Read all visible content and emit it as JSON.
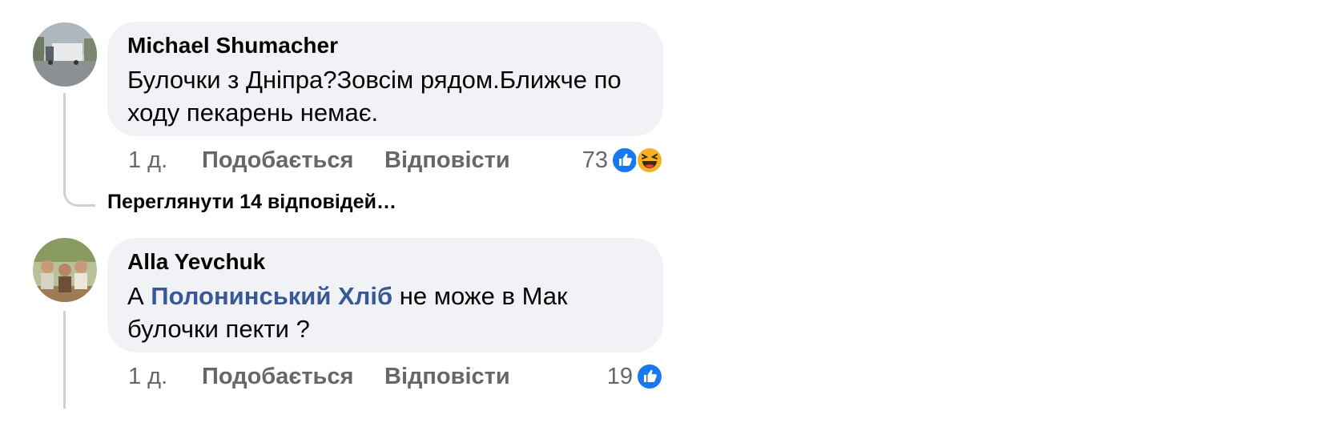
{
  "comments": [
    {
      "author": "Michael Shumacher",
      "text": "Булочки з Дніпра?Зовсім рядом.Ближче по ходу пекарень немає.",
      "time": "1 д.",
      "like_label": "Подобається",
      "reply_label": "Відповісти",
      "reaction_count": "73",
      "reactions": [
        "like-icon",
        "haha-icon"
      ],
      "view_replies": "Переглянути 14 відповідей…"
    },
    {
      "author": "Alla Yevchuk",
      "text_before": "А ",
      "mention": "Полонинський Хліб",
      "text_after": " не може в Мак булочки пекти ?",
      "time": "1 д.",
      "like_label": "Подобається",
      "reply_label": "Відповісти",
      "reaction_count": "19",
      "reactions": [
        "like-icon"
      ]
    }
  ],
  "colors": {
    "bubble": "#f0f2f5",
    "secondary_text": "#65676b",
    "mention": "#385898",
    "like_blue": "#1877f2",
    "haha_yellow": "#f7b125",
    "thread_line": "#ced0d4"
  }
}
